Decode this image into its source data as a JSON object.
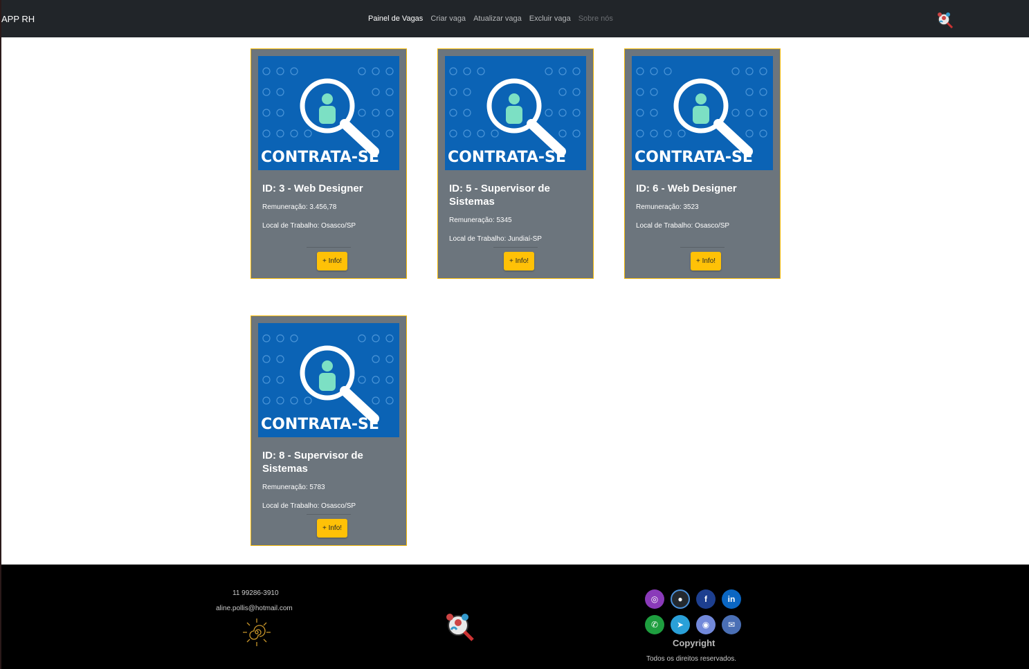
{
  "navbar": {
    "brand": "APP RH",
    "links": [
      "Painel de Vagas",
      "Criar vaga",
      "Atualizar vaga",
      "Excluir vaga",
      "Sobre nós"
    ]
  },
  "card_image_text": "CONTRATA-SE",
  "info_label": "+ Info!",
  "jobs": [
    {
      "title": "ID: 3 - Web Designer",
      "salary": "Remuneração: 3.456,78",
      "location": "Local de Trabalho: Osasco/SP"
    },
    {
      "title": "ID: 5 - Supervisor de Sistemas",
      "salary": "Remuneração: 5345",
      "location": "Local de Trabalho: Jundiaí-SP"
    },
    {
      "title": "ID: 6 - Web Designer",
      "salary": "Remuneração: 3523",
      "location": "Local de Trabalho: Osasco/SP"
    },
    {
      "title": "ID: 8 - Supervisor de Sistemas",
      "salary": "Remuneração: 5783",
      "location": "Local de Trabalho: Osasco/SP"
    }
  ],
  "footer": {
    "phone": "11 99286-3910",
    "email": "aline.pollis@hotmail.com",
    "copyright": "Copyright",
    "rights": "Todos os direitos reservados.",
    "social": [
      "instagram-icon",
      "github-icon",
      "facebook-icon",
      "linkedin-icon",
      "whatsapp-icon",
      "telegram-icon",
      "discord-icon",
      "email-icon"
    ]
  },
  "colors": {
    "navbar": "#212529",
    "card": "#6c757d",
    "card_border": "#f2b705",
    "button": "#ffc107",
    "footer": "#000000",
    "banner": "#0b63b5"
  }
}
